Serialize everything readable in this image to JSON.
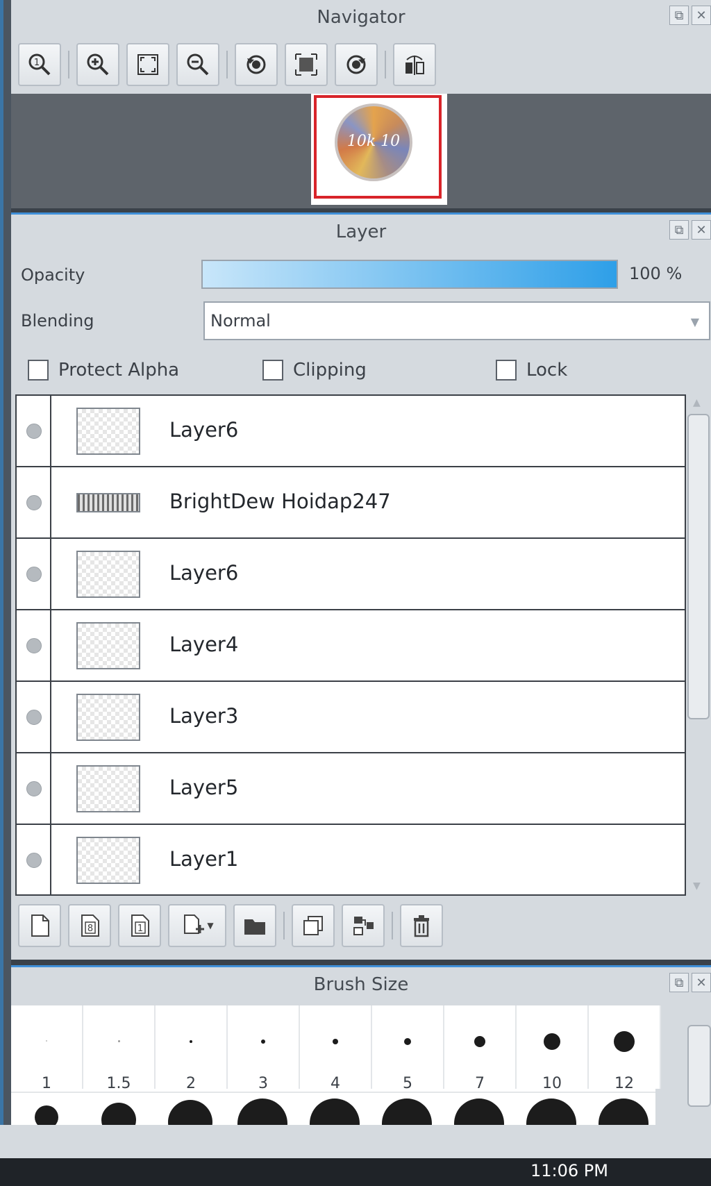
{
  "navigator": {
    "title": "Navigator"
  },
  "layer_panel": {
    "title": "Layer",
    "opacity_label": "Opacity",
    "opacity_value": "100 %",
    "opacity_fraction": 1.0,
    "blending_label": "Blending",
    "blending_value": "Normal",
    "protect_alpha_label": "Protect Alpha",
    "clipping_label": "Clipping",
    "lock_label": "Lock",
    "layers": [
      {
        "name": "Layer6"
      },
      {
        "name": "BrightDew Hoidap247"
      },
      {
        "name": "Layer6"
      },
      {
        "name": "Layer4"
      },
      {
        "name": "Layer3"
      },
      {
        "name": "Layer5"
      },
      {
        "name": "Layer1"
      }
    ]
  },
  "brush_panel": {
    "title": "Brush Size",
    "sizes": [
      "1",
      "1.5",
      "2",
      "3",
      "4",
      "5",
      "7",
      "10",
      "12"
    ]
  },
  "taskbar": {
    "time": "11:06 PM"
  },
  "colors": {
    "accent": "#2e9fe8",
    "nav_frame": "#d8242a",
    "panel": "#d5dadf"
  }
}
